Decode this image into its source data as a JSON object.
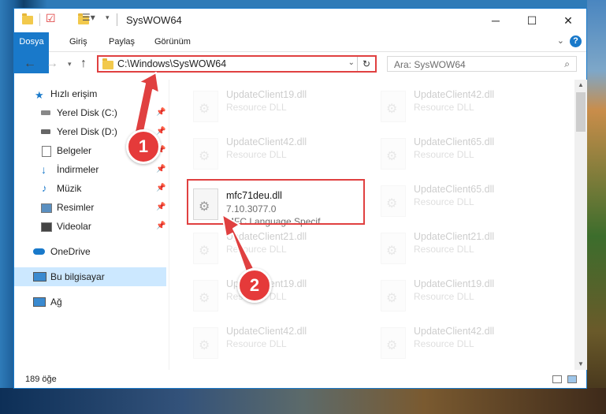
{
  "window": {
    "title": "SysWOW64",
    "controls": {
      "minimize": "─",
      "maximize": "☐",
      "close": "✕"
    }
  },
  "ribbon": {
    "tabs": [
      "Dosya",
      "Giriş",
      "Paylaş",
      "Görünüm"
    ],
    "help": "?"
  },
  "address": {
    "path": "C:\\Windows\\SysWOW64",
    "search_placeholder": "Ara: SysWOW64"
  },
  "sidebar": {
    "items": [
      {
        "label": "Hızlı erişim",
        "icon": "star-icon",
        "pinned": false
      },
      {
        "label": "Yerel Disk (C:)",
        "icon": "drive-icon",
        "pinned": true
      },
      {
        "label": "Yerel Disk (D:)",
        "icon": "drive-icon",
        "pinned": true
      },
      {
        "label": "Belgeler",
        "icon": "documents-icon",
        "pinned": true
      },
      {
        "label": "İndirmeler",
        "icon": "download-icon",
        "pinned": true
      },
      {
        "label": "Müzik",
        "icon": "music-icon",
        "pinned": true
      },
      {
        "label": "Resimler",
        "icon": "pictures-icon",
        "pinned": true
      },
      {
        "label": "Videolar",
        "icon": "videos-icon",
        "pinned": true
      },
      {
        "label": "OneDrive",
        "icon": "cloud-icon",
        "pinned": false
      },
      {
        "label": "Bu bilgisayar",
        "icon": "computer-icon",
        "pinned": false
      },
      {
        "label": "Ağ",
        "icon": "network-icon",
        "pinned": false
      }
    ]
  },
  "files": {
    "highlighted": {
      "name": "mfc71deu.dll",
      "version": "7.10.3077.0",
      "description": "MFC Language Specif..."
    },
    "left_column": [
      {
        "name": "UpdateClient19.dll",
        "type": "Resource DLL"
      },
      {
        "name": "UpdateClient42.dll",
        "type": "Resource DLL"
      },
      {
        "name": "UpdateClient21.dll",
        "type": "Resource DLL"
      },
      {
        "name": "UpdateClient19.dll",
        "type": "Resource DLL"
      },
      {
        "name": "UpdateClient42.dll",
        "type": "Resource DLL"
      }
    ],
    "right_column": [
      {
        "name": "UpdateClient42.dll",
        "type": "Resource DLL"
      },
      {
        "name": "UpdateClient65.dll",
        "type": "Resource DLL"
      },
      {
        "name": "UpdateClient65.dll",
        "type": "Resource DLL"
      },
      {
        "name": "UpdateClient21.dll",
        "type": "Resource DLL"
      },
      {
        "name": "UpdateClient19.dll",
        "type": "Resource DLL"
      },
      {
        "name": "UpdateClient42.dll",
        "type": "Resource DLL"
      }
    ]
  },
  "status": {
    "item_count": "189 öğe"
  },
  "annotations": {
    "step1": "1",
    "step2": "2",
    "arrow_color": "#e04040"
  }
}
